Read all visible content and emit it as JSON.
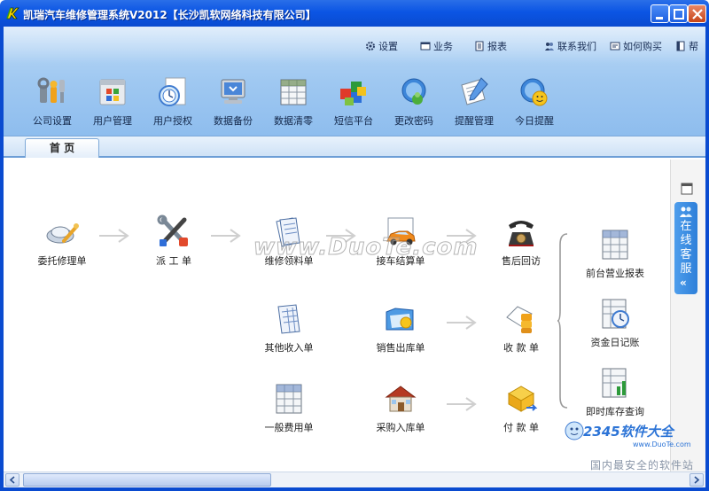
{
  "window": {
    "title": "凯瑞汽车维修管理系统V2012【长沙凯软网络科技有限公司】",
    "titlebar_color": "#0b55e4"
  },
  "top_links": [
    {
      "label": "设置",
      "icon": "gear-icon"
    },
    {
      "label": "业务",
      "icon": "window-icon"
    },
    {
      "label": "报表",
      "icon": "report-icon"
    },
    {
      "label": "联系我们",
      "icon": "contacts-icon"
    },
    {
      "label": "如何购买",
      "icon": "cart-icon"
    },
    {
      "label": "帮",
      "icon": "help-icon"
    }
  ],
  "toolbar": [
    {
      "label": "公司设置",
      "icon": "company-settings-icon"
    },
    {
      "label": "用户管理",
      "icon": "user-management-icon"
    },
    {
      "label": "用户授权",
      "icon": "user-authorization-icon"
    },
    {
      "label": "数据备份",
      "icon": "data-backup-icon"
    },
    {
      "label": "数据清零",
      "icon": "data-clear-icon"
    },
    {
      "label": "短信平台",
      "icon": "sms-platform-icon"
    },
    {
      "label": "更改密码",
      "icon": "change-password-icon"
    },
    {
      "label": "提醒管理",
      "icon": "reminder-management-icon"
    },
    {
      "label": "今日提醒",
      "icon": "today-reminder-icon"
    }
  ],
  "tabs": [
    {
      "label": "首 页",
      "active": true
    }
  ],
  "flow": {
    "entrust": "委托修理单",
    "dispatch": "派 工 单",
    "parts_request": "维修领料单",
    "checkout": "接车结算单",
    "followup": "售后回访",
    "other_income": "其他收入单",
    "sales_out": "销售出库单",
    "receipt": "收 款 单",
    "general_expense": "一般费用单",
    "purchase_in": "采购入库单",
    "payment": "付 款 单",
    "front_desk_report": "前台营业报表",
    "cash_journal": "资金日记账",
    "stock_query": "即时库存查询"
  },
  "side_panel": {
    "label": "在线客服",
    "chevron": "«"
  },
  "watermark": "www.DuoTe.com",
  "badge": {
    "logo": "2345软件大全",
    "url": "www.DuoTe.com",
    "slogan": "国内最安全的软件站"
  }
}
